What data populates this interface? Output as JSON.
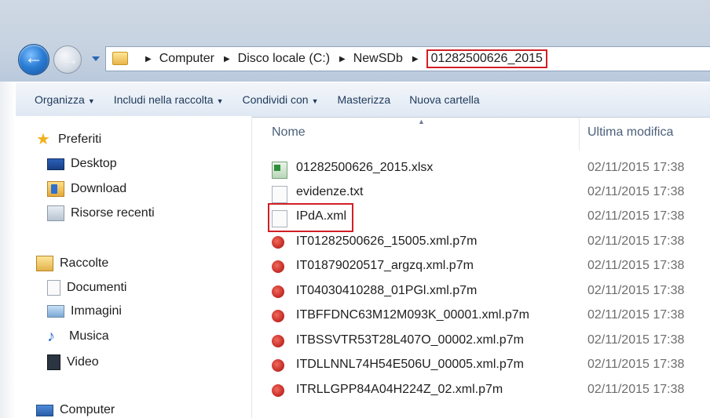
{
  "address_bar": {
    "crumbs": [
      "Computer",
      "Disco locale (C:)",
      "NewSDb"
    ],
    "current": "01282500626_2015"
  },
  "toolbar": {
    "organize": "Organizza",
    "include": "Includi nella raccolta",
    "share": "Condividi con",
    "burn": "Masterizza",
    "new_folder": "Nuova cartella"
  },
  "nav": {
    "favorites": "Preferiti",
    "desktop": "Desktop",
    "download": "Download",
    "recent": "Risorse recenti",
    "libraries": "Raccolte",
    "documents": "Documenti",
    "images": "Immagini",
    "music": "Musica",
    "video": "Video",
    "computer": "Computer"
  },
  "columns": {
    "name": "Nome",
    "modified": "Ultima modifica"
  },
  "files": [
    {
      "name": "01282500626_2015.xlsx",
      "modified": "02/11/2015 17:38",
      "icon": "excel-icon"
    },
    {
      "name": "evidenze.txt",
      "modified": "02/11/2015 17:38",
      "icon": "text-file-icon"
    },
    {
      "name": "IPdA.xml",
      "modified": "02/11/2015 17:38",
      "icon": "xml-file-icon"
    },
    {
      "name": "IT01282500626_15005.xml.p7m",
      "modified": "02/11/2015 17:38",
      "icon": "signed-file-icon"
    },
    {
      "name": "IT01879020517_argzq.xml.p7m",
      "modified": "02/11/2015 17:38",
      "icon": "signed-file-icon"
    },
    {
      "name": "IT04030410288_01PGl.xml.p7m",
      "modified": "02/11/2015 17:38",
      "icon": "signed-file-icon"
    },
    {
      "name": "ITBFFDNC63M12M093K_00001.xml.p7m",
      "modified": "02/11/2015 17:38",
      "icon": "signed-file-icon"
    },
    {
      "name": "ITBSSVTR53T28L407O_00002.xml.p7m",
      "modified": "02/11/2015 17:38",
      "icon": "signed-file-icon"
    },
    {
      "name": "ITDLLNNL74H54E506U_00005.xml.p7m",
      "modified": "02/11/2015 17:38",
      "icon": "signed-file-icon"
    },
    {
      "name": "ITRLLGPP84A04H224Z_02.xml.p7m",
      "modified": "02/11/2015 17:38",
      "icon": "signed-file-icon"
    }
  ],
  "highlight_color": "#d01f25"
}
